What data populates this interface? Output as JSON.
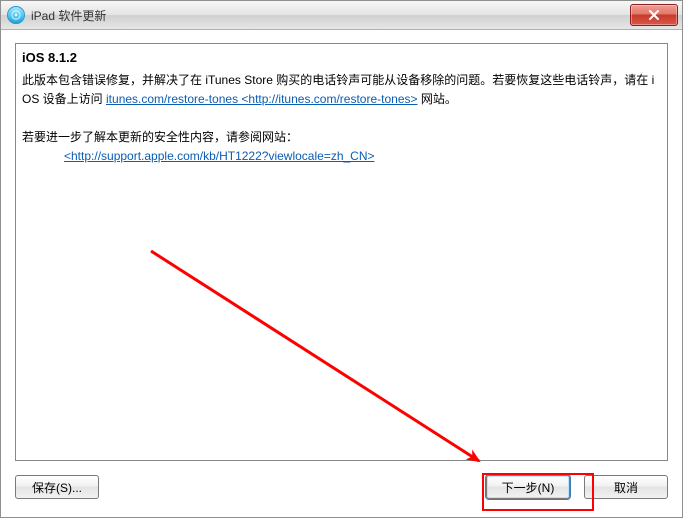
{
  "titlebar": {
    "title": "iPad 软件更新"
  },
  "content": {
    "heading": "iOS 8.1.2",
    "para1": {
      "pre": "此版本包含错误修复，并解决了在 iTunes Store 购买的电话铃声可能从设备移除的问题。若要恢复这些电话铃声，请在 iOS 设备上访问 ",
      "link_text": "itunes.com/restore-tones <http://itunes.com/restore-tones>",
      "post": " 网站。"
    },
    "para2": {
      "line1": "若要进一步了解本更新的安全性内容，请参阅网站：",
      "link_text": "<http://support.apple.com/kb/HT1222?viewlocale=zh_CN>"
    }
  },
  "buttons": {
    "save": "保存(S)...",
    "next": "下一步(N)",
    "cancel": "取消"
  },
  "annotation": {
    "highlight_target": "next-button",
    "arrow_color": "#ff0000"
  }
}
